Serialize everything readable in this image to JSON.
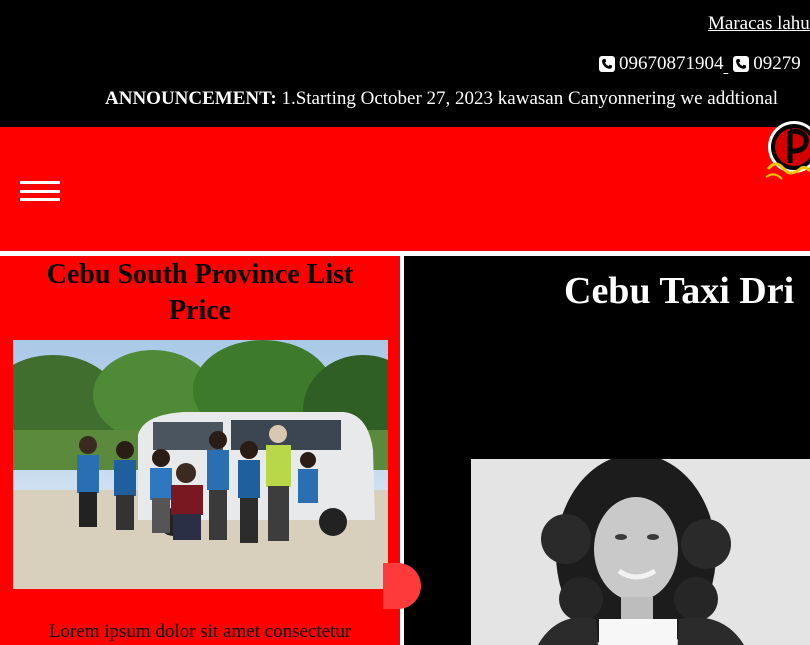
{
  "topbar": {
    "address": "Maracas lahu",
    "phones": [
      "09670871904",
      "09279"
    ],
    "announcement_label": "ANNOUNCEMENT:",
    "announcement_text": " 1.Starting October 27, 2023 kawasan Canyonnering we addtional"
  },
  "colors": {
    "brand_red": "#ff0000",
    "topbar_bg": "#000000",
    "text_light": "#ffffff"
  },
  "icons": [
    "phone-icon",
    "menu-icon",
    "brand-logo"
  ],
  "left_panel": {
    "title": "Cebu South Province List Price",
    "body": "Lorem ipsum dolor sit amet consectetur"
  },
  "right_panel": {
    "title": "Cebu Taxi Dri"
  }
}
